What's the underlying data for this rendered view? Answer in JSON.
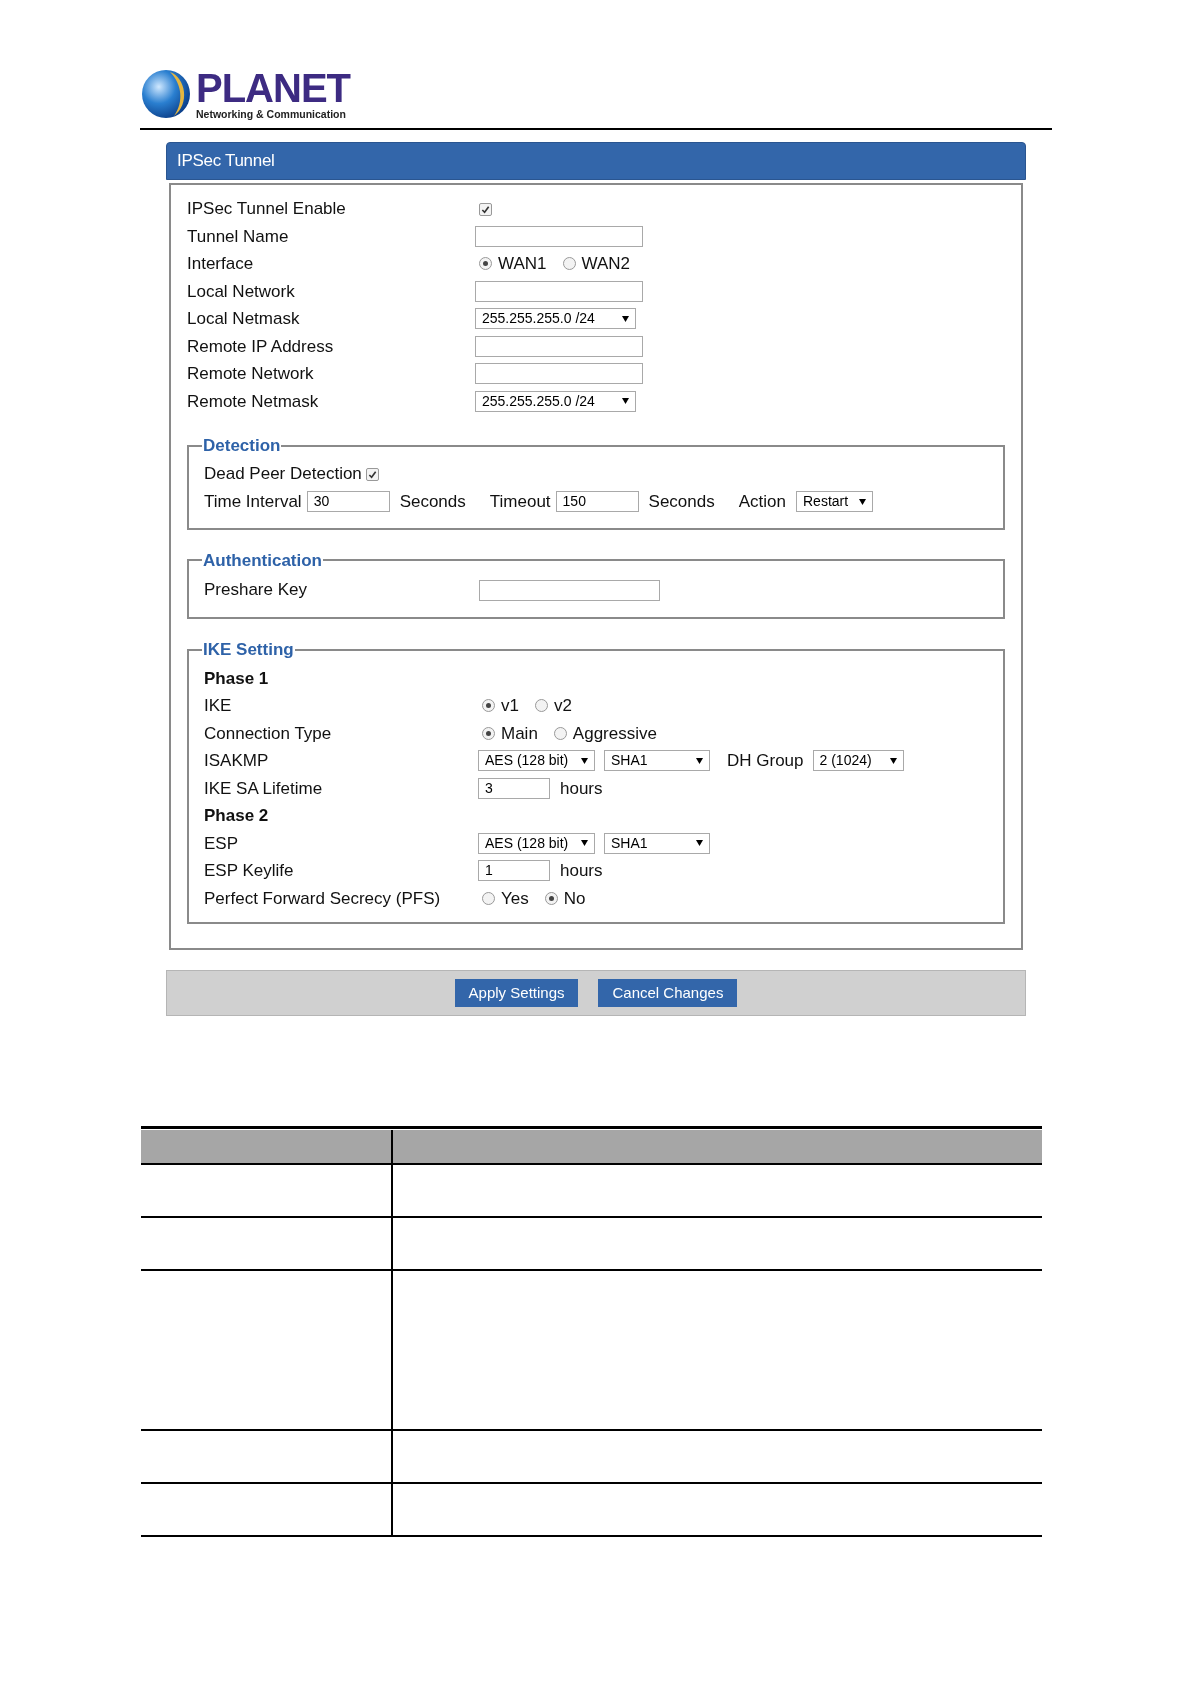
{
  "logo": {
    "name": "PLANET",
    "tagline": "Networking & Communication"
  },
  "panel": {
    "title": "IPSec Tunnel"
  },
  "fields": [
    {
      "kind": "checkbox",
      "label": "IPSec Tunnel Enable",
      "checked": true
    },
    {
      "kind": "text",
      "label": "Tunnel Name"
    },
    {
      "kind": "radio",
      "label": "Interface",
      "options": [
        {
          "label": "WAN1",
          "selected": true
        },
        {
          "label": "WAN2",
          "selected": false
        }
      ]
    },
    {
      "kind": "text",
      "label": "Local Network"
    },
    {
      "kind": "select",
      "label": "Local Netmask",
      "value": "255.255.255.0 /24"
    },
    {
      "kind": "text",
      "label": "Remote IP Address"
    },
    {
      "kind": "text",
      "label": "Remote Network"
    },
    {
      "kind": "select",
      "label": "Remote Netmask",
      "value": "255.255.255.0 /24"
    }
  ],
  "detection": {
    "legend": "Detection",
    "dpd": {
      "label": "Dead Peer Detection",
      "checked": true
    },
    "interval": {
      "label": "Time Interval",
      "value": "30",
      "unit": "Seconds"
    },
    "timeout": {
      "label": "Timeout",
      "value": "150",
      "unit": "Seconds"
    },
    "action": {
      "label": "Action",
      "value": "Restart"
    }
  },
  "authentication": {
    "legend": "Authentication",
    "label": "Preshare Key"
  },
  "ike": {
    "legend": "IKE Setting",
    "rows": [
      {
        "kind": "heading",
        "label": "Phase 1"
      },
      {
        "kind": "radio",
        "label": "IKE",
        "options": [
          {
            "label": "v1",
            "selected": true
          },
          {
            "label": "v2",
            "selected": false
          }
        ]
      },
      {
        "kind": "radio",
        "label": "Connection Type",
        "options": [
          {
            "label": "Main",
            "selected": true
          },
          {
            "label": "Aggressive",
            "selected": false
          }
        ]
      },
      {
        "kind": "selects",
        "label": "ISAKMP",
        "selects": [
          "AES (128 bit)",
          "SHA1"
        ],
        "extra": {
          "label": "DH Group",
          "value": "2 (1024)"
        }
      },
      {
        "kind": "text",
        "label": "IKE SA Lifetime",
        "value": "3",
        "unit": "hours"
      },
      {
        "kind": "heading",
        "label": "Phase 2"
      },
      {
        "kind": "selects",
        "label": "ESP",
        "selects": [
          "AES (128 bit)",
          "SHA1"
        ]
      },
      {
        "kind": "text",
        "label": "ESP Keylife",
        "value": "1",
        "unit": "hours"
      },
      {
        "kind": "radio",
        "label": "Perfect Forward Secrecy (PFS)",
        "options": [
          {
            "label": "Yes",
            "selected": false
          },
          {
            "label": "No",
            "selected": true
          }
        ]
      }
    ]
  },
  "buttons": [
    "Apply Settings",
    "Cancel Changes"
  ],
  "table": {
    "rows": [
      {
        "kind": "short"
      },
      {
        "kind": "short"
      },
      {
        "kind": "tall"
      },
      {
        "kind": "short"
      },
      {
        "kind": "short"
      }
    ]
  }
}
